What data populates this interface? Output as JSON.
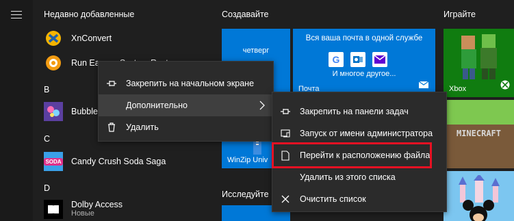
{
  "applist": {
    "recent_title": "Недавно добавленные",
    "apps_recent": [
      {
        "name": "XnConvert"
      },
      {
        "name": "Run Eassos System Restore"
      }
    ],
    "letters": {
      "b": "B",
      "c": "C",
      "d": "D"
    },
    "bubble": {
      "name": "Bubble"
    },
    "candy": {
      "name": "Candy Crush Soda Saga",
      "icon_text": "SODA"
    },
    "dolby": {
      "name": "Dolby Access",
      "sub": "Новые"
    }
  },
  "groups": {
    "create": "Создавайте",
    "play": "Играйте",
    "explore": "Исследуйте"
  },
  "tiles": {
    "calendar_day": "четверг",
    "mail_heading": "Вся ваша почта в одной службе",
    "mail_more": "И многое другое...",
    "mail_label": "Почта",
    "winzip_label": "WinZip Univ",
    "xbox_label": "Xbox",
    "minecraft_text": "MINECRAFT"
  },
  "context_menu_1": {
    "pin_start": "Закрепить на начальном экране",
    "more": "Дополнительно",
    "delete": "Удалить"
  },
  "context_menu_2": {
    "pin_taskbar": "Закрепить на панели задач",
    "run_admin": "Запуск от имени администратора",
    "open_location": "Перейти к расположению файла",
    "remove_list": "Удалить из этого списка",
    "clear_list": "Очистить список"
  },
  "colors": {
    "accent": "#0078d7",
    "highlight_box": "#e81123",
    "menu_bg": "#2b2b2b",
    "xbox_green": "#107c10"
  }
}
